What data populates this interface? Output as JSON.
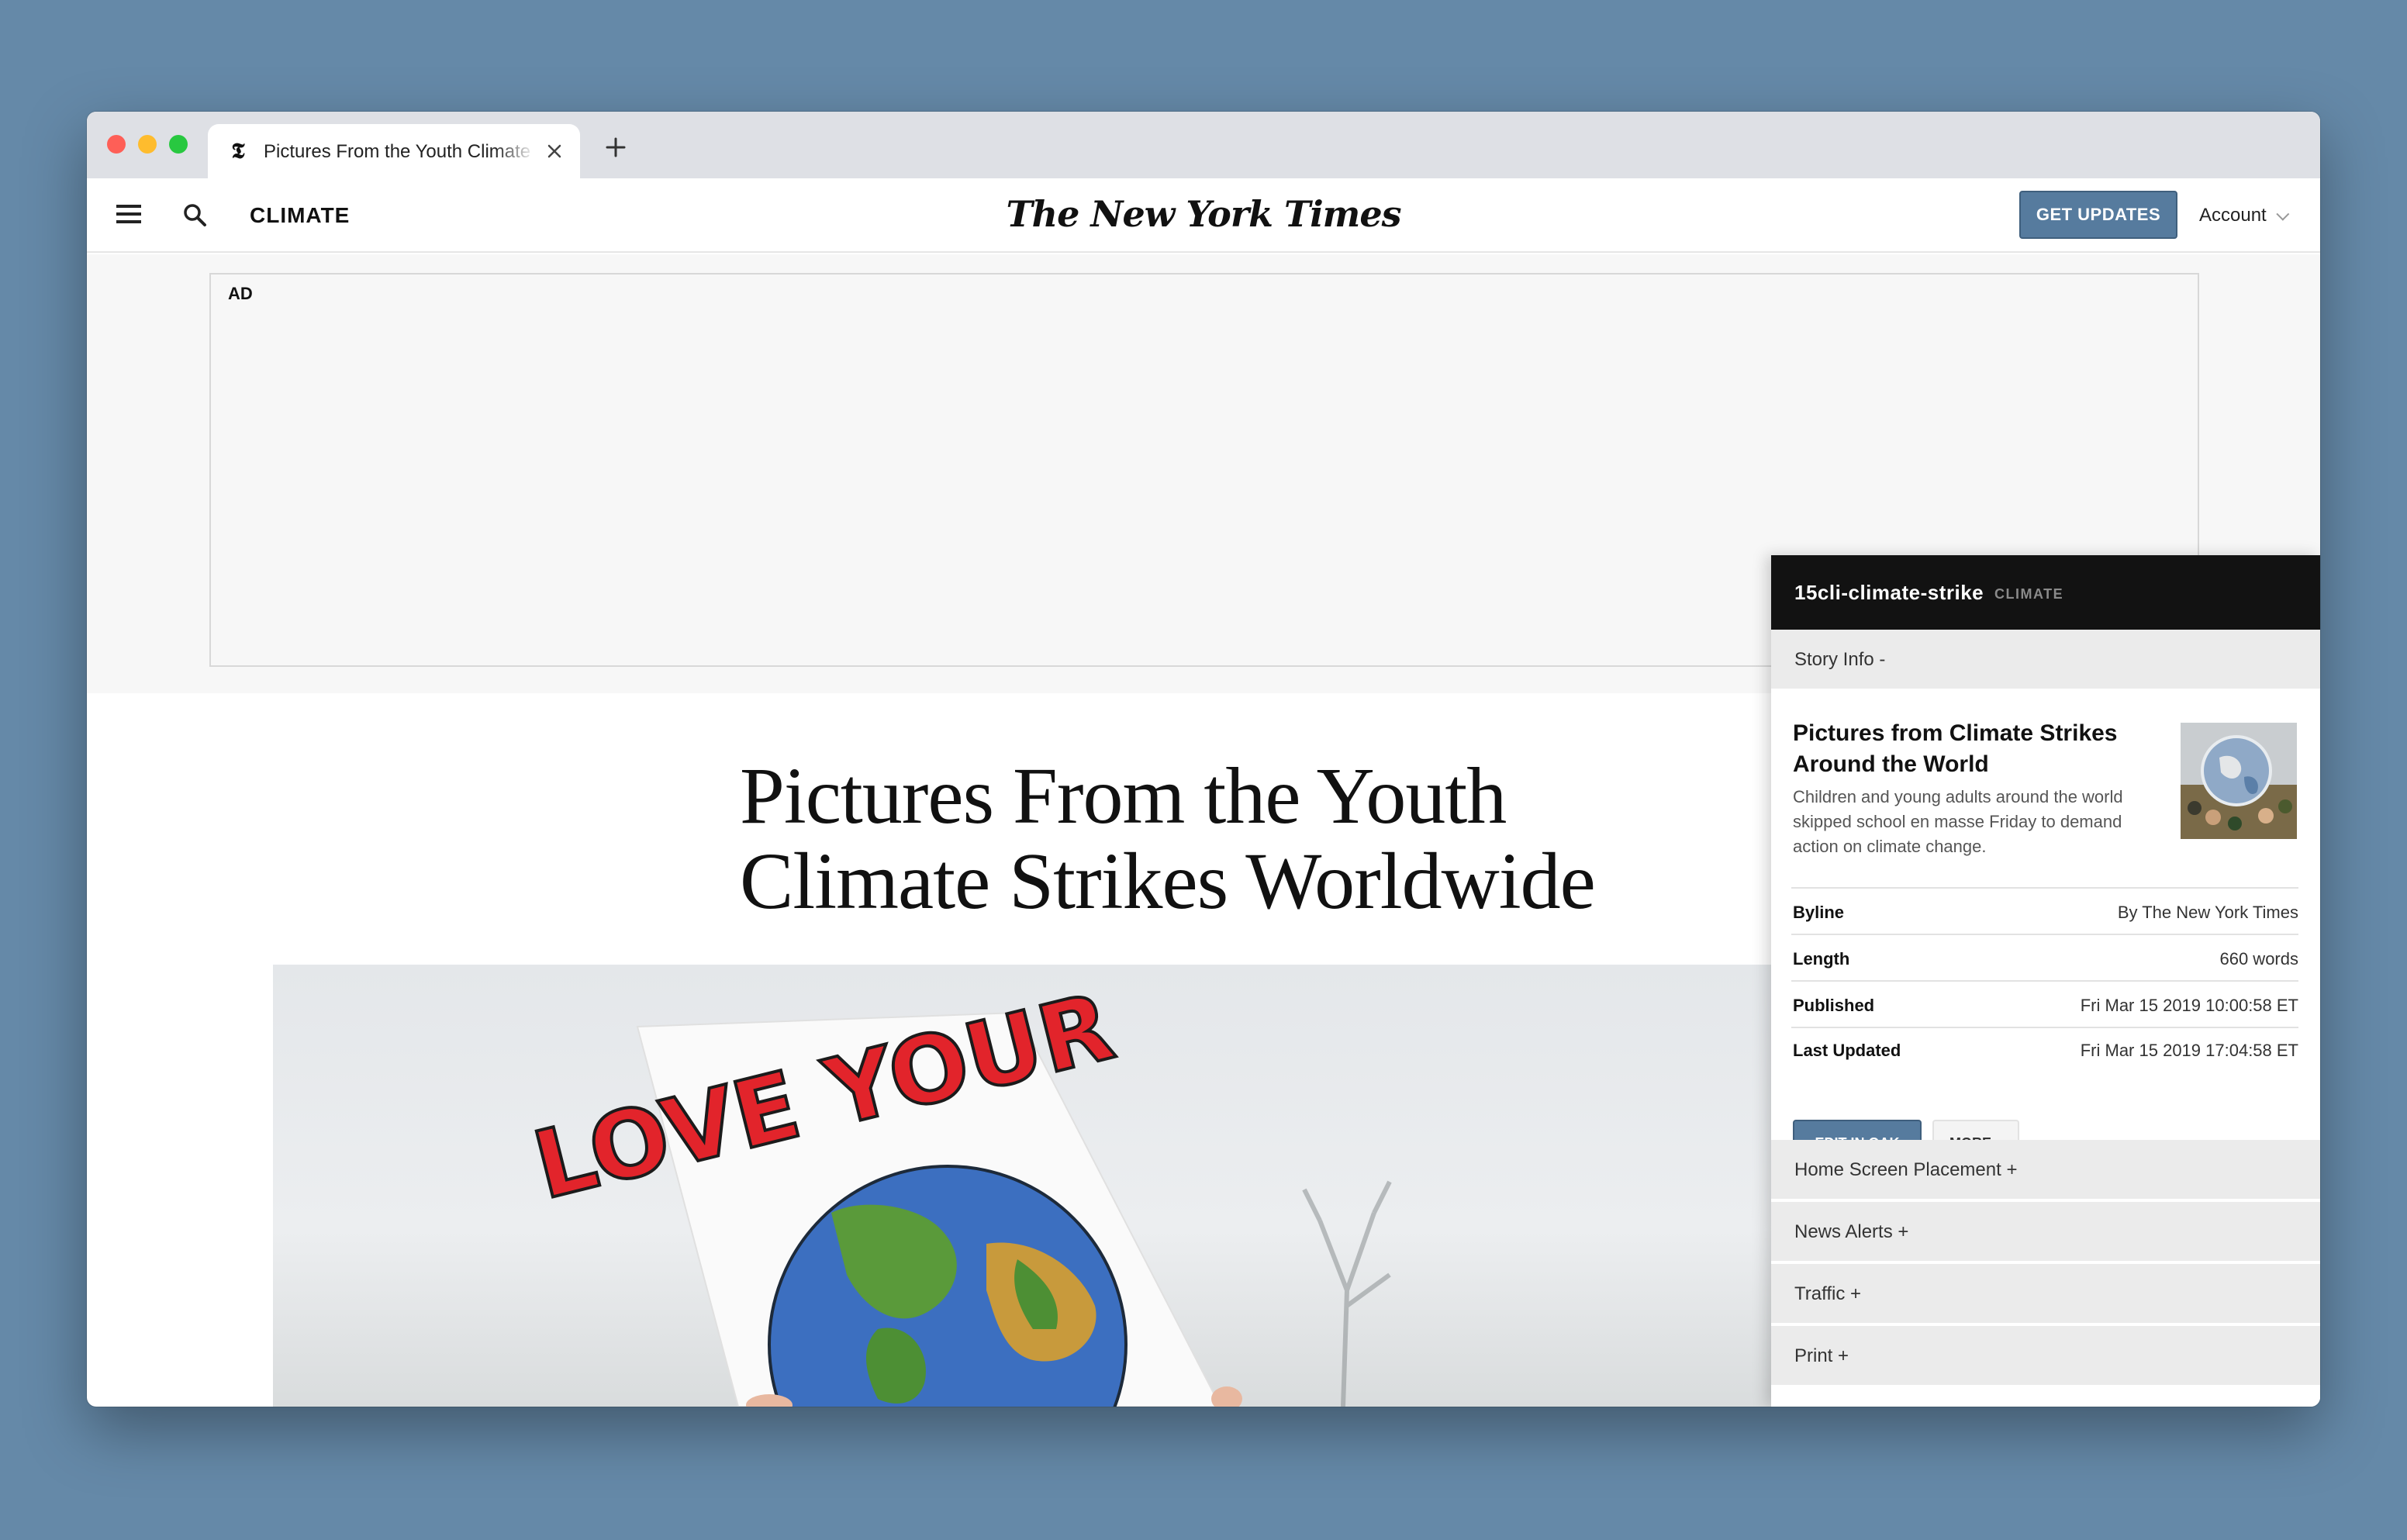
{
  "browser": {
    "tab_title": "Pictures From the Youth Climate Strikes Worldwide",
    "favicon": "𝕿"
  },
  "header": {
    "section": "CLIMATE",
    "masthead": "The New York Times",
    "get_updates": "GET UPDATES",
    "account": "Account"
  },
  "ad": {
    "label": "AD"
  },
  "article": {
    "headline_line1": "Pictures From the Youth",
    "headline_line2": "Climate Strikes Worldwide",
    "sign_text": "LOVE YOUR"
  },
  "panel": {
    "slug": "15cli-climate-strike",
    "section": "CLIMATE",
    "story_info": "Story Info  -",
    "story_title": "Pictures from Climate Strikes Around the World",
    "story_desc": "Children and young adults around the world skipped school en masse Friday to demand action on climate change.",
    "meta": [
      {
        "key": "Byline",
        "value": "By The New York Times"
      },
      {
        "key": "Length",
        "value": "660 words"
      },
      {
        "key": "Published",
        "value": "Fri Mar 15 2019 10:00:58 ET"
      },
      {
        "key": "Last Updated",
        "value": "Fri Mar 15 2019 17:04:58 ET"
      }
    ],
    "edit_button": "EDIT IN OAK",
    "more_button": "MORE ▾",
    "sections": [
      {
        "label": "Home Screen Placement  +"
      },
      {
        "label": "News Alerts  +"
      },
      {
        "label": "Traffic  +"
      },
      {
        "label": "Print  +"
      }
    ]
  }
}
